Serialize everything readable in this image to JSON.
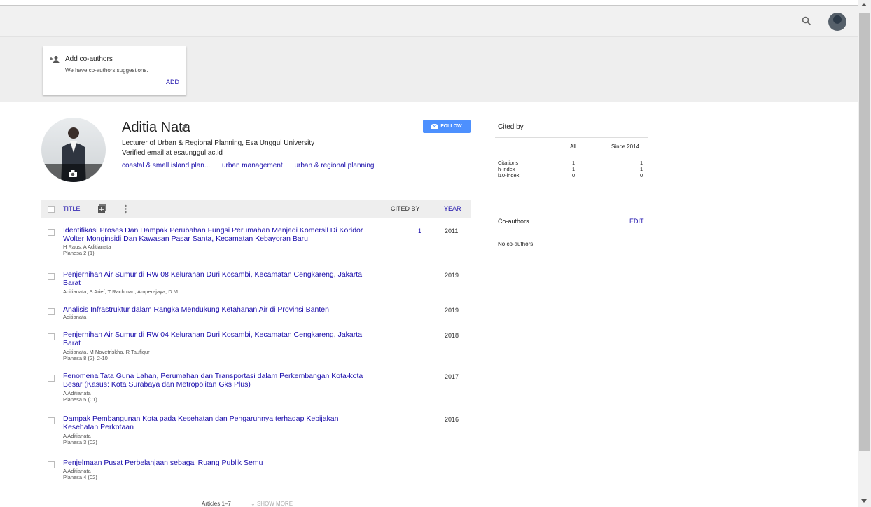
{
  "header": {
    "search_icon": "search-icon",
    "avatar_icon": "account-avatar"
  },
  "coauthor_suggestion": {
    "title": "Add co-authors",
    "subtitle": "We have co-authors suggestions.",
    "action": "ADD"
  },
  "profile": {
    "name": "Aditia Nata",
    "affiliation": "Lecturer of Urban & Regional Planning, Esa Unggul University",
    "email": "Verified email at esaunggul.ac.id",
    "interests": [
      "coastal & small island plan...",
      "urban management",
      "urban & regional planning"
    ],
    "follow_label": "FOLLOW",
    "accent": "#4d90fe"
  },
  "table": {
    "title_header": "TITLE",
    "cited_header": "CITED BY",
    "year_header": "YEAR"
  },
  "articles": [
    {
      "title": "Identifikasi Proses Dan Dampak Perubahan Fungsi Perumahan Menjadi Komersil Di Koridor Wolter Monginsidi Dan Kawasan Pasar Santa, Kecamatan Kebayoran Baru",
      "authors": "H Raus, A Aditianata",
      "venue": "Planesa 2 (1)",
      "cited": "1",
      "year": "2011"
    },
    {
      "title": "Penjernihan Air Sumur di RW 08 Kelurahan Duri Kosambi, Kecamatan Cengkareng, Jakarta Barat",
      "authors": "Aditianata, S Arief, T Rachman, Amperajaya, D M.",
      "venue": "",
      "cited": "",
      "year": "2019"
    },
    {
      "title": "Analisis Infrastruktur dalam Rangka Mendukung Ketahanan Air di Provinsi Banten",
      "authors": "Aditianata",
      "venue": "",
      "cited": "",
      "year": "2019"
    },
    {
      "title": "Penjernihan Air Sumur di RW 04 Kelurahan Duri Kosambi, Kecamatan Cengkareng, Jakarta Barat",
      "authors": "Aditianata, M Novetriskha, R Taufiqur",
      "venue": "Planesa 8 (2), 2-10",
      "cited": "",
      "year": "2018"
    },
    {
      "title": "Fenomena Tata Guna Lahan, Perumahan dan Transportasi dalam Perkembangan Kota-kota Besar (Kasus: Kota Surabaya dan Metropolitan Gks Plus)",
      "authors": "A Aditianata",
      "venue": "Planesa 5 (01)",
      "cited": "",
      "year": "2017"
    },
    {
      "title": "Dampak Pembangunan Kota pada Kesehatan dan Pengaruhnya terhadap Kebijakan Kesehatan Perkotaan",
      "authors": "A Aditianata",
      "venue": "Planesa 3 (02)",
      "cited": "",
      "year": "2016"
    },
    {
      "title": "Penjelmaan Pusat Perbelanjaan sebagai Ruang Publik Semu",
      "authors": "A Aditianata",
      "venue": "Planesa 4 (02)",
      "cited": "",
      "year": ""
    }
  ],
  "footer": {
    "articles_count": "Articles 1–7",
    "show_more": "SHOW MORE"
  },
  "cited_by": {
    "title": "Cited by",
    "headers": [
      "All",
      "Since 2014"
    ],
    "rows": [
      {
        "label": "Citations",
        "all": "1",
        "since": "1"
      },
      {
        "label": "h-index",
        "all": "1",
        "since": "1"
      },
      {
        "label": "i10-index",
        "all": "0",
        "since": "0"
      }
    ]
  },
  "coauthors": {
    "title": "Co-authors",
    "edit": "EDIT",
    "empty": "No co-authors"
  }
}
